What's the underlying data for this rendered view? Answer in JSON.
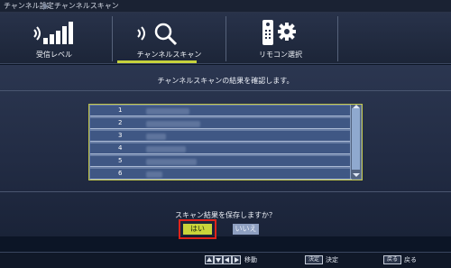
{
  "breadcrumb": {
    "parent": "チャンネル設定",
    "current": "チャンネルスキャン"
  },
  "tabs": [
    {
      "label": "受信レベル",
      "icon": "signal-level-icon"
    },
    {
      "label": "チャンネルスキャン",
      "icon": "channel-scan-icon",
      "selected": true
    },
    {
      "label": "リモコン選択",
      "icon": "remote-settings-icon"
    }
  ],
  "main": {
    "title": "チャンネルスキャンの結果を確認します。",
    "results": [
      {
        "num": "1"
      },
      {
        "num": "2"
      },
      {
        "num": "3"
      },
      {
        "num": "4"
      },
      {
        "num": "5"
      },
      {
        "num": "6"
      }
    ],
    "question": "スキャン結果を保存しますか？",
    "yes_label": "はい",
    "no_label": "いいえ"
  },
  "footer": {
    "move_label": "移動",
    "enter_key": "決定",
    "enter_label": "決定",
    "back_key": "戻る",
    "back_label": "戻る"
  },
  "colors": {
    "accent": "#c9d43a",
    "focus": "#e0241b",
    "list_row": "#3f5784"
  }
}
